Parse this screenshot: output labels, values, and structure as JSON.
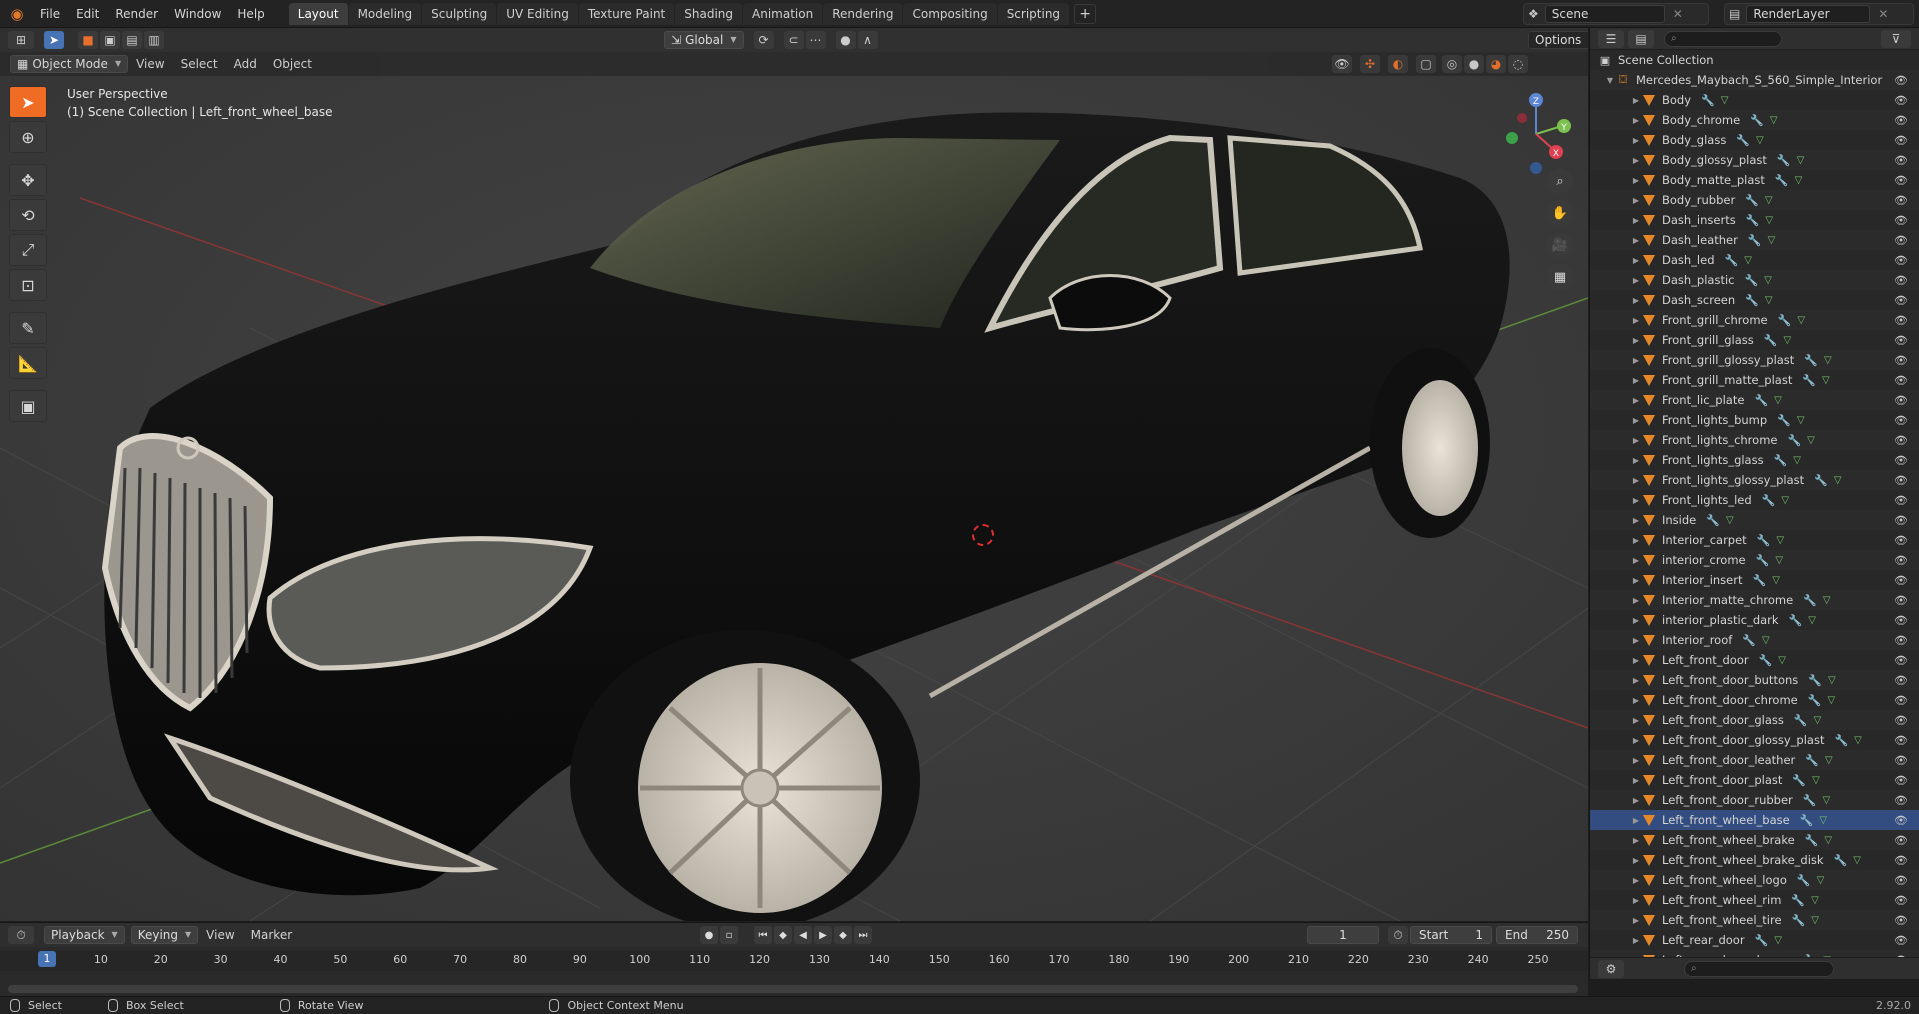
{
  "topbar": {
    "menus": [
      "File",
      "Edit",
      "Render",
      "Window",
      "Help"
    ],
    "workspaces": [
      "Layout",
      "Modeling",
      "Sculpting",
      "UV Editing",
      "Texture Paint",
      "Shading",
      "Animation",
      "Rendering",
      "Compositing",
      "Scripting"
    ],
    "active_workspace": "Layout",
    "add_workspace": "+",
    "scene_name": "Scene",
    "view_layer": "RenderLayer"
  },
  "viewport": {
    "mode": "Object Mode",
    "menus": [
      "View",
      "Select",
      "Add",
      "Object"
    ],
    "transform_orientation": "Global",
    "options_label": "Options",
    "overlay_line1": "User Perspective",
    "overlay_line2": "(1) Scene Collection | Left_front_wheel_base",
    "gizmo_axes": {
      "x": "X",
      "y": "Y",
      "z": "Z"
    }
  },
  "outliner": {
    "root": "Scene Collection",
    "collection": "Mercedes_Maybach_S_560_Simple_Interior",
    "selected": "Left_front_wheel_base",
    "items": [
      "Body",
      "Body_chrome",
      "Body_glass",
      "Body_glossy_plast",
      "Body_matte_plast",
      "Body_rubber",
      "Dash_inserts",
      "Dash_leather",
      "Dash_led",
      "Dash_plastic",
      "Dash_screen",
      "Front_grill_chrome",
      "Front_grill_glass",
      "Front_grill_glossy_plast",
      "Front_grill_matte_plast",
      "Front_lic_plate",
      "Front_lights_bump",
      "Front_lights_chrome",
      "Front_lights_glass",
      "Front_lights_glossy_plast",
      "Front_lights_led",
      "Inside",
      "Interior_carpet",
      "interior_crome",
      "Interior_insert",
      "Interior_matte_chrome",
      "interior_plastic_dark",
      "Interior_roof",
      "Left_front_door",
      "Left_front_door_buttons",
      "Left_front_door_chrome",
      "Left_front_door_glass",
      "Left_front_door_glossy_plast",
      "Left_front_door_leather",
      "Left_front_door_plast",
      "Left_front_door_rubber",
      "Left_front_wheel_base",
      "Left_front_wheel_brake",
      "Left_front_wheel_brake_disk",
      "Left_front_wheel_logo",
      "Left_front_wheel_rim",
      "Left_front_wheel_tire",
      "Left_rear_door",
      "Left_rear_door_chrome"
    ]
  },
  "timeline": {
    "menus": [
      "Playback",
      "Keying",
      "View",
      "Marker"
    ],
    "current_frame": "1",
    "start_label": "Start",
    "start_value": "1",
    "end_label": "End",
    "end_value": "250",
    "ticks": [
      "1",
      "10",
      "20",
      "30",
      "40",
      "50",
      "60",
      "70",
      "80",
      "90",
      "100",
      "110",
      "120",
      "130",
      "140",
      "150",
      "160",
      "170",
      "180",
      "190",
      "200",
      "210",
      "220",
      "230",
      "240",
      "250"
    ]
  },
  "statusbar": {
    "select": "Select",
    "box_select": "Box Select",
    "rotate_view": "Rotate View",
    "context_menu": "Object Context Menu",
    "version": "2.92.0"
  }
}
